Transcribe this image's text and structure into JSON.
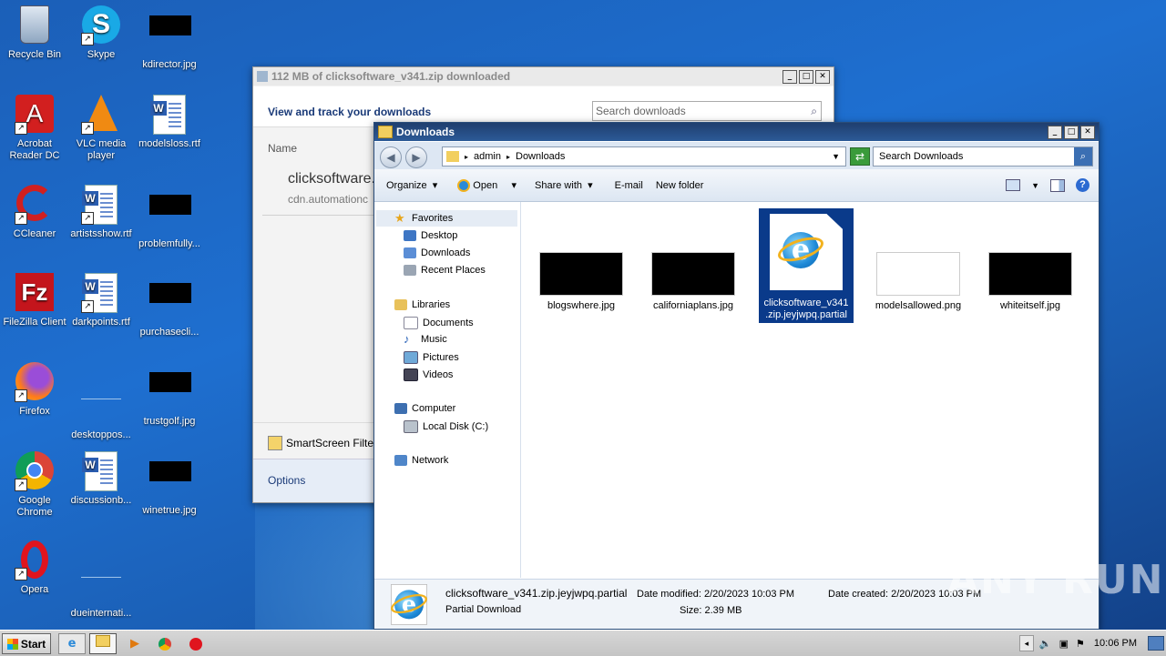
{
  "desktop": {
    "icons": [
      {
        "label": "Recycle Bin"
      },
      {
        "label": "Skype"
      },
      {
        "label": "kdirector.jpg"
      },
      {
        "label": "Acrobat Reader DC"
      },
      {
        "label": "VLC media player"
      },
      {
        "label": "modelsloss.rtf"
      },
      {
        "label": "CCleaner"
      },
      {
        "label": "artistsshow.rtf"
      },
      {
        "label": "problemfully..."
      },
      {
        "label": "FileZilla Client"
      },
      {
        "label": "darkpoints.rtf"
      },
      {
        "label": "purchasecli..."
      },
      {
        "label": "Firefox"
      },
      {
        "label": "desktoppos..."
      },
      {
        "label": "trustgolf.jpg"
      },
      {
        "label": "Google Chrome"
      },
      {
        "label": "discussionb..."
      },
      {
        "label": "winetrue.jpg"
      },
      {
        "label": "Opera"
      },
      {
        "label": "dueinternati..."
      }
    ]
  },
  "downloads_window": {
    "title": "112 MB of clicksoftware_v341.zip downloaded",
    "heading": "View and track your downloads",
    "search_placeholder": "Search downloads",
    "col_name": "Name",
    "item_name": "clicksoftware.",
    "item_source": "cdn.automationc",
    "smartscreen": "SmartScreen Filte",
    "options": "Options"
  },
  "explorer": {
    "title": "Downloads",
    "path": [
      "admin",
      "Downloads"
    ],
    "search_placeholder": "Search Downloads",
    "toolbar": {
      "organize": "Organize",
      "open": "Open",
      "share": "Share with",
      "email": "E-mail",
      "new_folder": "New folder"
    },
    "nav": {
      "favorites": "Favorites",
      "desktop": "Desktop",
      "downloads": "Downloads",
      "recent": "Recent Places",
      "libraries": "Libraries",
      "documents": "Documents",
      "music": "Music",
      "pictures": "Pictures",
      "videos": "Videos",
      "computer": "Computer",
      "local_disk": "Local Disk (C:)",
      "network": "Network"
    },
    "files": [
      {
        "name": "blogswhere.jpg"
      },
      {
        "name": "californiaplans.jpg"
      },
      {
        "name": "clicksoftware_v341\n.zip.jeyjwpq.partial"
      },
      {
        "name": "modelsallowed.png"
      },
      {
        "name": "whiteitself.jpg"
      }
    ],
    "status": {
      "filename": "clicksoftware_v341.zip.jeyjwpq.partial",
      "type": "Partial Download",
      "modified": "Date modified: 2/20/2023 10:03 PM",
      "size": "Size: 2.39 MB",
      "created": "Date created: 2/20/2023 10:03 PM"
    }
  },
  "taskbar": {
    "start": "Start",
    "clock": "10:06 PM"
  },
  "watermark": "ANY RUN"
}
